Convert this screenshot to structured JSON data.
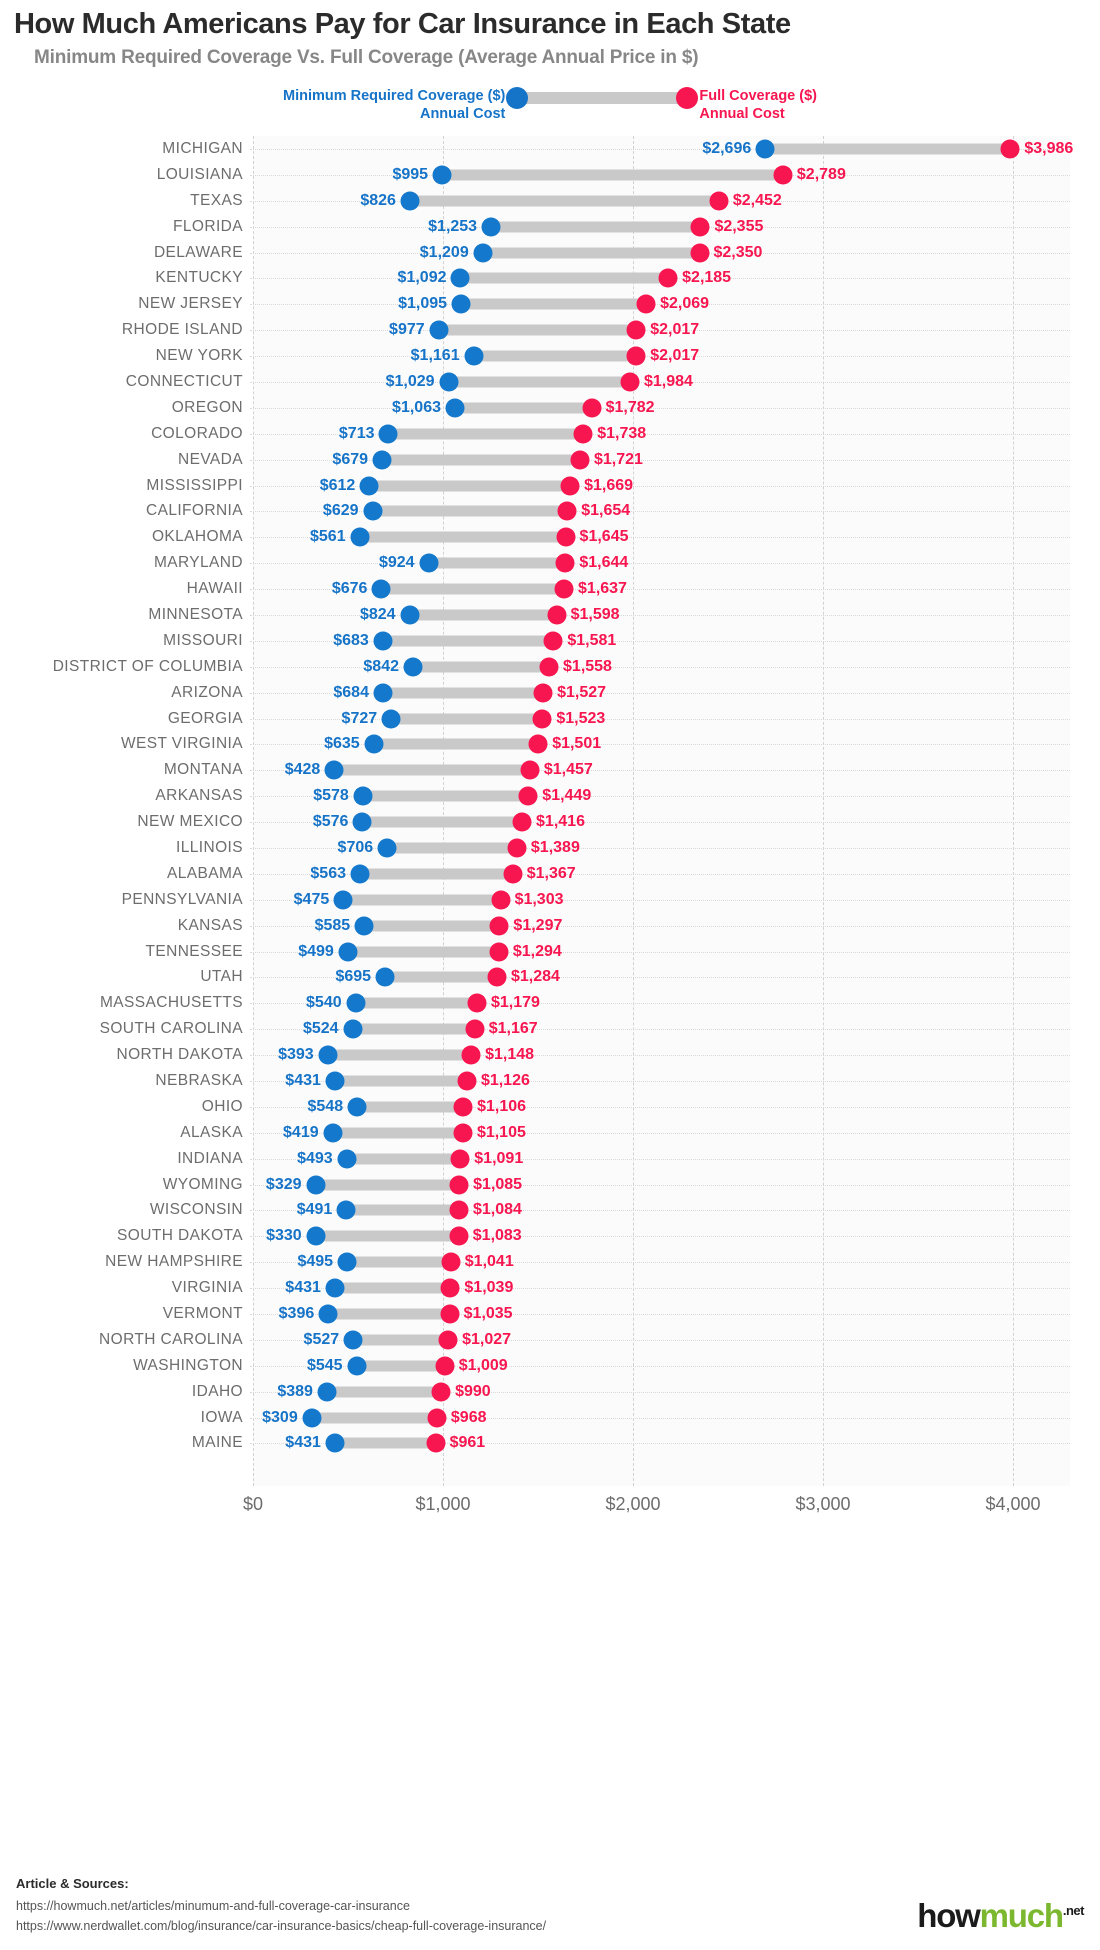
{
  "header": {
    "title": "How Much Americans Pay for Car Insurance in Each State",
    "subtitle": "Minimum Required Coverage Vs. Full Coverage (Average Annual Price in $)"
  },
  "legend": {
    "min_line1": "Minimum Required Coverage ($)",
    "min_line2": "Annual Cost",
    "full_line1": "Full Coverage ($)",
    "full_line2": "Annual Cost",
    "min_color": "#1573c8",
    "full_color": "#f7164f",
    "connector_color": "#c9c9c9"
  },
  "footer": {
    "sources_title": "Article & Sources:",
    "source_1": "https://howmuch.net/articles/minumum-and-full-coverage-car-insurance",
    "source_2": "https://www.nerdwallet.com/blog/insurance/car-insurance-basics/cheap-full-coverage-insurance/",
    "logo_how": "how",
    "logo_much": "much",
    "logo_net": ".net"
  },
  "chart_data": {
    "type": "bar",
    "subtype": "dumbbell",
    "title": "How Much Americans Pay for Car Insurance in Each State",
    "subtitle": "Minimum Required Coverage Vs. Full Coverage (Average Annual Price in $)",
    "xlabel": "",
    "ylabel": "",
    "xlim": [
      0,
      4300
    ],
    "xticks": [
      0,
      1000,
      2000,
      3000,
      4000
    ],
    "xticklabels": [
      "$0",
      "$1,000",
      "$2,000",
      "$3,000",
      "$4,000"
    ],
    "grid": true,
    "legend_position": "top",
    "series": [
      {
        "name": "Minimum Required Coverage ($) Annual Cost",
        "color": "#1573c8"
      },
      {
        "name": "Full Coverage ($) Annual Cost",
        "color": "#f7164f"
      }
    ],
    "categories": [
      "MICHIGAN",
      "LOUISIANA",
      "TEXAS",
      "FLORIDA",
      "DELAWARE",
      "KENTUCKY",
      "NEW JERSEY",
      "RHODE ISLAND",
      "NEW YORK",
      "CONNECTICUT",
      "OREGON",
      "COLORADO",
      "NEVADA",
      "MISSISSIPPI",
      "CALIFORNIA",
      "OKLAHOMA",
      "MARYLAND",
      "HAWAII",
      "MINNESOTA",
      "MISSOURI",
      "DISTRICT OF COLUMBIA",
      "ARIZONA",
      "GEORGIA",
      "WEST VIRGINIA",
      "MONTANA",
      "ARKANSAS",
      "NEW MEXICO",
      "ILLINOIS",
      "ALABAMA",
      "PENNSYLVANIA",
      "KANSAS",
      "TENNESSEE",
      "UTAH",
      "MASSACHUSETTS",
      "SOUTH CAROLINA",
      "NORTH DAKOTA",
      "NEBRASKA",
      "OHIO",
      "ALASKA",
      "INDIANA",
      "WYOMING",
      "WISCONSIN",
      "SOUTH DAKOTA",
      "NEW HAMPSHIRE",
      "VIRGINIA",
      "VERMONT",
      "NORTH CAROLINA",
      "WASHINGTON",
      "IDAHO",
      "IOWA",
      "MAINE"
    ],
    "rows": [
      {
        "state": "MICHIGAN",
        "min": 2696,
        "full": 3986,
        "min_label": "$2,696",
        "full_label": "$3,986"
      },
      {
        "state": "LOUISIANA",
        "min": 995,
        "full": 2789,
        "min_label": "$995",
        "full_label": "$2,789"
      },
      {
        "state": "TEXAS",
        "min": 826,
        "full": 2452,
        "min_label": "$826",
        "full_label": "$2,452"
      },
      {
        "state": "FLORIDA",
        "min": 1253,
        "full": 2355,
        "min_label": "$1,253",
        "full_label": "$2,355"
      },
      {
        "state": "DELAWARE",
        "min": 1209,
        "full": 2350,
        "min_label": "$1,209",
        "full_label": "$2,350"
      },
      {
        "state": "KENTUCKY",
        "min": 1092,
        "full": 2185,
        "min_label": "$1,092",
        "full_label": "$2,185"
      },
      {
        "state": "NEW JERSEY",
        "min": 1095,
        "full": 2069,
        "min_label": "$1,095",
        "full_label": "$2,069"
      },
      {
        "state": "RHODE ISLAND",
        "min": 977,
        "full": 2017,
        "min_label": "$977",
        "full_label": "$2,017"
      },
      {
        "state": "NEW YORK",
        "min": 1161,
        "full": 2017,
        "min_label": "$1,161",
        "full_label": "$2,017"
      },
      {
        "state": "CONNECTICUT",
        "min": 1029,
        "full": 1984,
        "min_label": "$1,029",
        "full_label": "$1,984"
      },
      {
        "state": "OREGON",
        "min": 1063,
        "full": 1782,
        "min_label": "$1,063",
        "full_label": "$1,782"
      },
      {
        "state": "COLORADO",
        "min": 713,
        "full": 1738,
        "min_label": "$713",
        "full_label": "$1,738"
      },
      {
        "state": "NEVADA",
        "min": 679,
        "full": 1721,
        "min_label": "$679",
        "full_label": "$1,721"
      },
      {
        "state": "MISSISSIPPI",
        "min": 612,
        "full": 1669,
        "min_label": "$612",
        "full_label": "$1,669"
      },
      {
        "state": "CALIFORNIA",
        "min": 629,
        "full": 1654,
        "min_label": "$629",
        "full_label": "$1,654"
      },
      {
        "state": "OKLAHOMA",
        "min": 561,
        "full": 1645,
        "min_label": "$561",
        "full_label": "$1,645"
      },
      {
        "state": "MARYLAND",
        "min": 924,
        "full": 1644,
        "min_label": "$924",
        "full_label": "$1,644"
      },
      {
        "state": "HAWAII",
        "min": 676,
        "full": 1637,
        "min_label": "$676",
        "full_label": "$1,637"
      },
      {
        "state": "MINNESOTA",
        "min": 824,
        "full": 1598,
        "min_label": "$824",
        "full_label": "$1,598"
      },
      {
        "state": "MISSOURI",
        "min": 683,
        "full": 1581,
        "min_label": "$683",
        "full_label": "$1,581"
      },
      {
        "state": "DISTRICT OF COLUMBIA",
        "min": 842,
        "full": 1558,
        "min_label": "$842",
        "full_label": "$1,558"
      },
      {
        "state": "ARIZONA",
        "min": 684,
        "full": 1527,
        "min_label": "$684",
        "full_label": "$1,527"
      },
      {
        "state": "GEORGIA",
        "min": 727,
        "full": 1523,
        "min_label": "$727",
        "full_label": "$1,523"
      },
      {
        "state": "WEST VIRGINIA",
        "min": 635,
        "full": 1501,
        "min_label": "$635",
        "full_label": "$1,501"
      },
      {
        "state": "MONTANA",
        "min": 428,
        "full": 1457,
        "min_label": "$428",
        "full_label": "$1,457"
      },
      {
        "state": "ARKANSAS",
        "min": 578,
        "full": 1449,
        "min_label": "$578",
        "full_label": "$1,449"
      },
      {
        "state": "NEW MEXICO",
        "min": 576,
        "full": 1416,
        "min_label": "$576",
        "full_label": "$1,416"
      },
      {
        "state": "ILLINOIS",
        "min": 706,
        "full": 1389,
        "min_label": "$706",
        "full_label": "$1,389"
      },
      {
        "state": "ALABAMA",
        "min": 563,
        "full": 1367,
        "min_label": "$563",
        "full_label": "$1,367"
      },
      {
        "state": "PENNSYLVANIA",
        "min": 475,
        "full": 1303,
        "min_label": "$475",
        "full_label": "$1,303"
      },
      {
        "state": "KANSAS",
        "min": 585,
        "full": 1297,
        "min_label": "$585",
        "full_label": "$1,297"
      },
      {
        "state": "TENNESSEE",
        "min": 499,
        "full": 1294,
        "min_label": "$499",
        "full_label": "$1,294"
      },
      {
        "state": "UTAH",
        "min": 695,
        "full": 1284,
        "min_label": "$695",
        "full_label": "$1,284"
      },
      {
        "state": "MASSACHUSETTS",
        "min": 540,
        "full": 1179,
        "min_label": "$540",
        "full_label": "$1,179"
      },
      {
        "state": "SOUTH CAROLINA",
        "min": 524,
        "full": 1167,
        "min_label": "$524",
        "full_label": "$1,167"
      },
      {
        "state": "NORTH DAKOTA",
        "min": 393,
        "full": 1148,
        "min_label": "$393",
        "full_label": "$1,148"
      },
      {
        "state": "NEBRASKA",
        "min": 431,
        "full": 1126,
        "min_label": "$431",
        "full_label": "$1,126"
      },
      {
        "state": "OHIO",
        "min": 548,
        "full": 1106,
        "min_label": "$548",
        "full_label": "$1,106"
      },
      {
        "state": "ALASKA",
        "min": 419,
        "full": 1105,
        "min_label": "$419",
        "full_label": "$1,105"
      },
      {
        "state": "INDIANA",
        "min": 493,
        "full": 1091,
        "min_label": "$493",
        "full_label": "$1,091"
      },
      {
        "state": "WYOMING",
        "min": 329,
        "full": 1085,
        "min_label": "$329",
        "full_label": "$1,085"
      },
      {
        "state": "WISCONSIN",
        "min": 491,
        "full": 1084,
        "min_label": "$491",
        "full_label": "$1,084"
      },
      {
        "state": "SOUTH DAKOTA",
        "min": 330,
        "full": 1083,
        "min_label": "$330",
        "full_label": "$1,083"
      },
      {
        "state": "NEW HAMPSHIRE",
        "min": 495,
        "full": 1041,
        "min_label": "$495",
        "full_label": "$1,041"
      },
      {
        "state": "VIRGINIA",
        "min": 431,
        "full": 1039,
        "min_label": "$431",
        "full_label": "$1,039"
      },
      {
        "state": "VERMONT",
        "min": 396,
        "full": 1035,
        "min_label": "$396",
        "full_label": "$1,035"
      },
      {
        "state": "NORTH CAROLINA",
        "min": 527,
        "full": 1027,
        "min_label": "$527",
        "full_label": "$1,027"
      },
      {
        "state": "WASHINGTON",
        "min": 545,
        "full": 1009,
        "min_label": "$545",
        "full_label": "$1,009"
      },
      {
        "state": "IDAHO",
        "min": 389,
        "full": 990,
        "min_label": "$389",
        "full_label": "$990"
      },
      {
        "state": "IOWA",
        "min": 309,
        "full": 968,
        "min_label": "$309",
        "full_label": "$968"
      },
      {
        "state": "MAINE",
        "min": 431,
        "full": 961,
        "min_label": "$431",
        "full_label": "$961"
      }
    ]
  }
}
